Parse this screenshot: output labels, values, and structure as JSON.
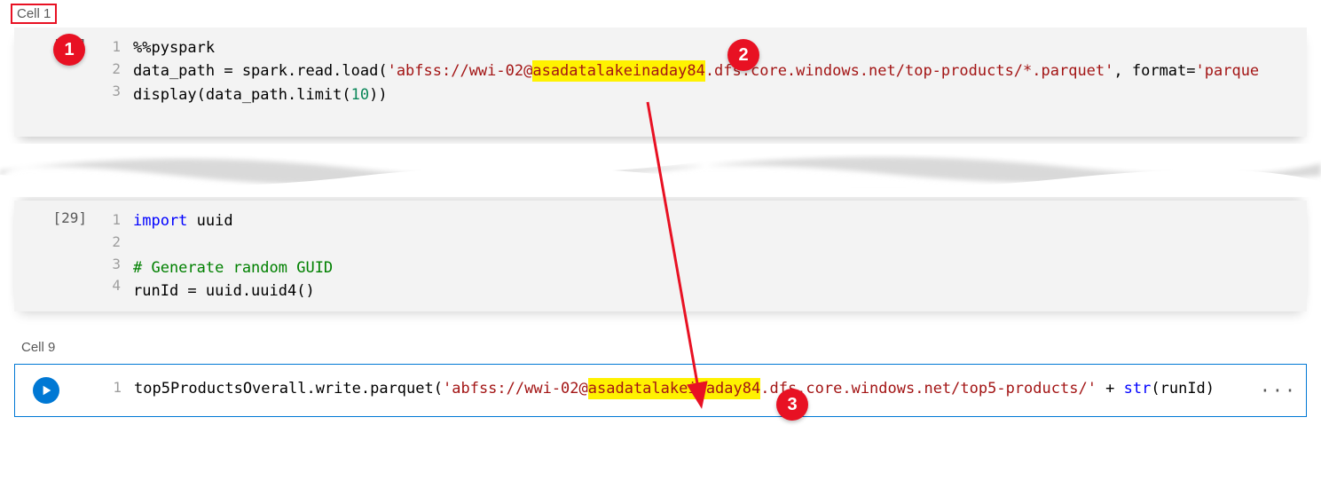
{
  "cell1": {
    "label": "Cell 1",
    "exec_count": "[22]",
    "ln1": "1",
    "ln2": "2",
    "ln3": "3",
    "code1_a": "%%pyspark",
    "code2_a": "data_path = spark.read.load(",
    "code2_str1": "'abfss://wwi-02@",
    "code2_hl": "asadatalakeinaday84",
    "code2_str2": ".dfs.core.windows.net/top-products/*.parquet'",
    "code2_b": ", format=",
    "code2_str3": "'parque",
    "code3_a": "display(data_path.limit(",
    "code3_num": "10",
    "code3_b": "))"
  },
  "cell29": {
    "exec_count": "[29]",
    "ln1": "1",
    "ln2": "2",
    "ln3": "3",
    "ln4": "4",
    "code1_kw": "import",
    "code1_rest": " uuid",
    "code3_comment": "# Generate random GUID",
    "code4": "runId = uuid.uuid4()"
  },
  "cell9": {
    "label": "Cell 9",
    "ln1": "1",
    "code_a": "top5ProductsOverall.write.parquet(",
    "code_str1": "'abfss://wwi-02@",
    "code_hl": "asadatalakeinaday84",
    "code_str2": ".dfs.core.windows.net/top5-products/'",
    "code_b": " + ",
    "code_kw": "str",
    "code_c": "(runId) ",
    "ellipsis": "···"
  },
  "callouts": {
    "c1": "1",
    "c2": "2",
    "c3": "3"
  }
}
